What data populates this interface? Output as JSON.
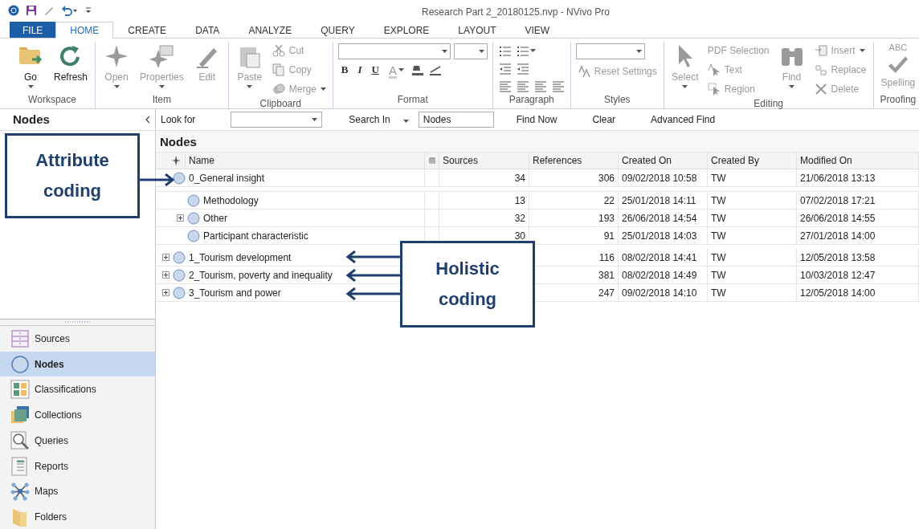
{
  "window": {
    "title": "Research Part 2_20180125.nvp - NVivo Pro"
  },
  "menu_tabs": [
    {
      "label": "FILE",
      "kind": "file",
      "selected": false
    },
    {
      "label": "HOME",
      "kind": "tab",
      "selected": true
    },
    {
      "label": "CREATE",
      "kind": "tab",
      "selected": false
    },
    {
      "label": "DATA",
      "kind": "tab",
      "selected": false
    },
    {
      "label": "ANALYZE",
      "kind": "tab",
      "selected": false
    },
    {
      "label": "QUERY",
      "kind": "tab",
      "selected": false
    },
    {
      "label": "EXPLORE",
      "kind": "tab",
      "selected": false
    },
    {
      "label": "LAYOUT",
      "kind": "tab",
      "selected": false
    },
    {
      "label": "VIEW",
      "kind": "tab",
      "selected": false
    }
  ],
  "ribbon": {
    "groups": [
      {
        "label": "Workspace",
        "columns": [
          [
            {
              "kind": "large",
              "label": "Go",
              "dropdown": true,
              "disabled": false
            }
          ],
          [
            {
              "kind": "large",
              "label": "Refresh",
              "dropdown": false,
              "disabled": false
            }
          ]
        ]
      },
      {
        "label": "Item",
        "columns": [
          [
            {
              "kind": "large",
              "label": "Open",
              "dropdown": true,
              "disabled": true
            }
          ],
          [
            {
              "kind": "large",
              "label": "Properties",
              "dropdown": true,
              "disabled": true
            }
          ],
          [
            {
              "kind": "large",
              "label": "Edit",
              "dropdown": false,
              "disabled": true
            }
          ]
        ]
      },
      {
        "label": "Clipboard",
        "columns": [
          [
            {
              "kind": "large",
              "label": "Paste",
              "dropdown": true,
              "disabled": true
            }
          ],
          [
            {
              "kind": "small",
              "label": "Cut",
              "dropdown": false,
              "disabled": true
            },
            {
              "kind": "small",
              "label": "Copy",
              "dropdown": false,
              "disabled": true
            },
            {
              "kind": "small",
              "label": "Merge",
              "dropdown": true,
              "disabled": true
            }
          ]
        ]
      },
      {
        "label": "Format",
        "rows": [
          [
            {
              "kind": "combo-wide"
            },
            {
              "kind": "combo-narrow"
            }
          ],
          [
            {
              "kind": "glyph",
              "label": "B",
              "dropdown": false
            },
            {
              "kind": "glyph",
              "label": "I",
              "dropdown": false
            },
            {
              "kind": "glyph",
              "label": "U",
              "dropdown": false
            },
            {
              "kind": "glyph",
              "label": "A",
              "dropdown": true
            },
            {
              "kind": "tool",
              "dropdown": false
            },
            {
              "kind": "tool",
              "dropdown": false
            }
          ]
        ]
      },
      {
        "label": "Paragraph",
        "rows": [
          [
            {
              "kind": "tool",
              "dropdown": false
            },
            {
              "kind": "tool",
              "dropdown": true
            }
          ],
          [
            {
              "kind": "tool",
              "dropdown": false
            },
            {
              "kind": "tool",
              "dropdown": false
            }
          ],
          [
            {
              "kind": "tool",
              "dropdown": false
            },
            {
              "kind": "tool",
              "dropdown": false
            },
            {
              "kind": "tool",
              "dropdown": false
            },
            {
              "kind": "tool",
              "dropdown": false
            }
          ]
        ]
      },
      {
        "label": "Styles",
        "rows": [
          [
            {
              "kind": "combo-mid"
            }
          ],
          [
            {
              "kind": "small",
              "label": "Reset Settings",
              "dropdown": false,
              "disabled": true
            }
          ]
        ]
      },
      {
        "label": "Editing",
        "columns": [
          [
            {
              "kind": "large",
              "label": "Select",
              "dropdown": true,
              "disabled": true
            }
          ],
          [
            {
              "kind": "small",
              "label": "PDF Selection",
              "dropdown": false,
              "disabled": true
            },
            {
              "kind": "small",
              "label": "Text",
              "dropdown": false,
              "disabled": true
            },
            {
              "kind": "small",
              "label": "Region",
              "dropdown": false,
              "disabled": true
            }
          ],
          [
            {
              "kind": "large",
              "label": "Find",
              "dropdown": true,
              "disabled": true
            }
          ],
          [
            {
              "kind": "small",
              "label": "Insert",
              "dropdown": true,
              "disabled": true
            },
            {
              "kind": "small",
              "label": "Replace",
              "dropdown": false,
              "disabled": true
            },
            {
              "kind": "small",
              "label": "Delete",
              "dropdown": false,
              "disabled": true
            }
          ]
        ]
      },
      {
        "label": "Proofing",
        "columns": [
          [
            {
              "kind": "large",
              "label": "Spelling",
              "icon_text": "ABC",
              "dropdown": false,
              "disabled": true
            }
          ]
        ]
      }
    ]
  },
  "sidebar": {
    "title": "Nodes",
    "items": [
      {
        "label": "Sources",
        "selected": false
      },
      {
        "label": "Nodes",
        "selected": true
      },
      {
        "label": "Classifications",
        "selected": false
      },
      {
        "label": "Collections",
        "selected": false
      },
      {
        "label": "Queries",
        "selected": false
      },
      {
        "label": "Reports",
        "selected": false
      },
      {
        "label": "Maps",
        "selected": false
      },
      {
        "label": "Folders",
        "selected": false
      }
    ]
  },
  "search_bar": {
    "look_for_label": "Look for",
    "search_in_label": "Search In",
    "search_in_value": "Nodes",
    "buttons": [
      "Find Now",
      "Clear",
      "Advanced Find"
    ]
  },
  "table": {
    "title": "Nodes",
    "columns": [
      {
        "kind": "icon"
      },
      {
        "kind": "text",
        "label": "Name"
      },
      {
        "kind": "icon"
      },
      {
        "kind": "text",
        "label": "Sources"
      },
      {
        "kind": "text",
        "label": "References"
      },
      {
        "kind": "text",
        "label": "Created On"
      },
      {
        "kind": "text",
        "label": "Created By"
      },
      {
        "kind": "text",
        "label": "Modified On"
      }
    ],
    "rows": [
      {
        "name": "0_General insight",
        "sources": "34",
        "references": "306",
        "created_on": "09/02/2018 10:58",
        "created_by": "TW",
        "modified_on": "21/06/2018 13:13",
        "children": [
          {
            "name": "Methodology",
            "sources": "13",
            "references": "22",
            "created_on": "25/01/2018 14:11",
            "created_by": "TW",
            "modified_on": "07/02/2018 17:21"
          },
          {
            "name": "Other",
            "expanded": false,
            "sources": "32",
            "references": "193",
            "created_on": "26/06/2018 14:54",
            "created_by": "TW",
            "modified_on": "26/06/2018 14:55"
          },
          {
            "name": "Participant characteristic",
            "sources": "30",
            "references": "91",
            "created_on": "25/01/2018 14:03",
            "created_by": "TW",
            "modified_on": "27/01/2018 14:00"
          }
        ]
      },
      {
        "name": "1_Tourism development",
        "expanded": false,
        "references": "116",
        "created_on": "08/02/2018 14:41",
        "created_by": "TW",
        "modified_on": "12/05/2018 13:58"
      },
      {
        "name": "2_Tourism, poverty and inequality",
        "expanded": false,
        "references": "381",
        "created_on": "08/02/2018 14:49",
        "created_by": "TW",
        "modified_on": "10/03/2018 12:47"
      },
      {
        "name": "3_Tourism and power",
        "expanded": false,
        "references": "247",
        "created_on": "09/02/2018 14:10",
        "created_by": "TW",
        "modified_on": "12/05/2018 14:00"
      }
    ]
  },
  "annotations": [
    {
      "kind": "callout",
      "label": "Attribute coding"
    },
    {
      "kind": "callout",
      "label": "Holistic coding"
    }
  ]
}
